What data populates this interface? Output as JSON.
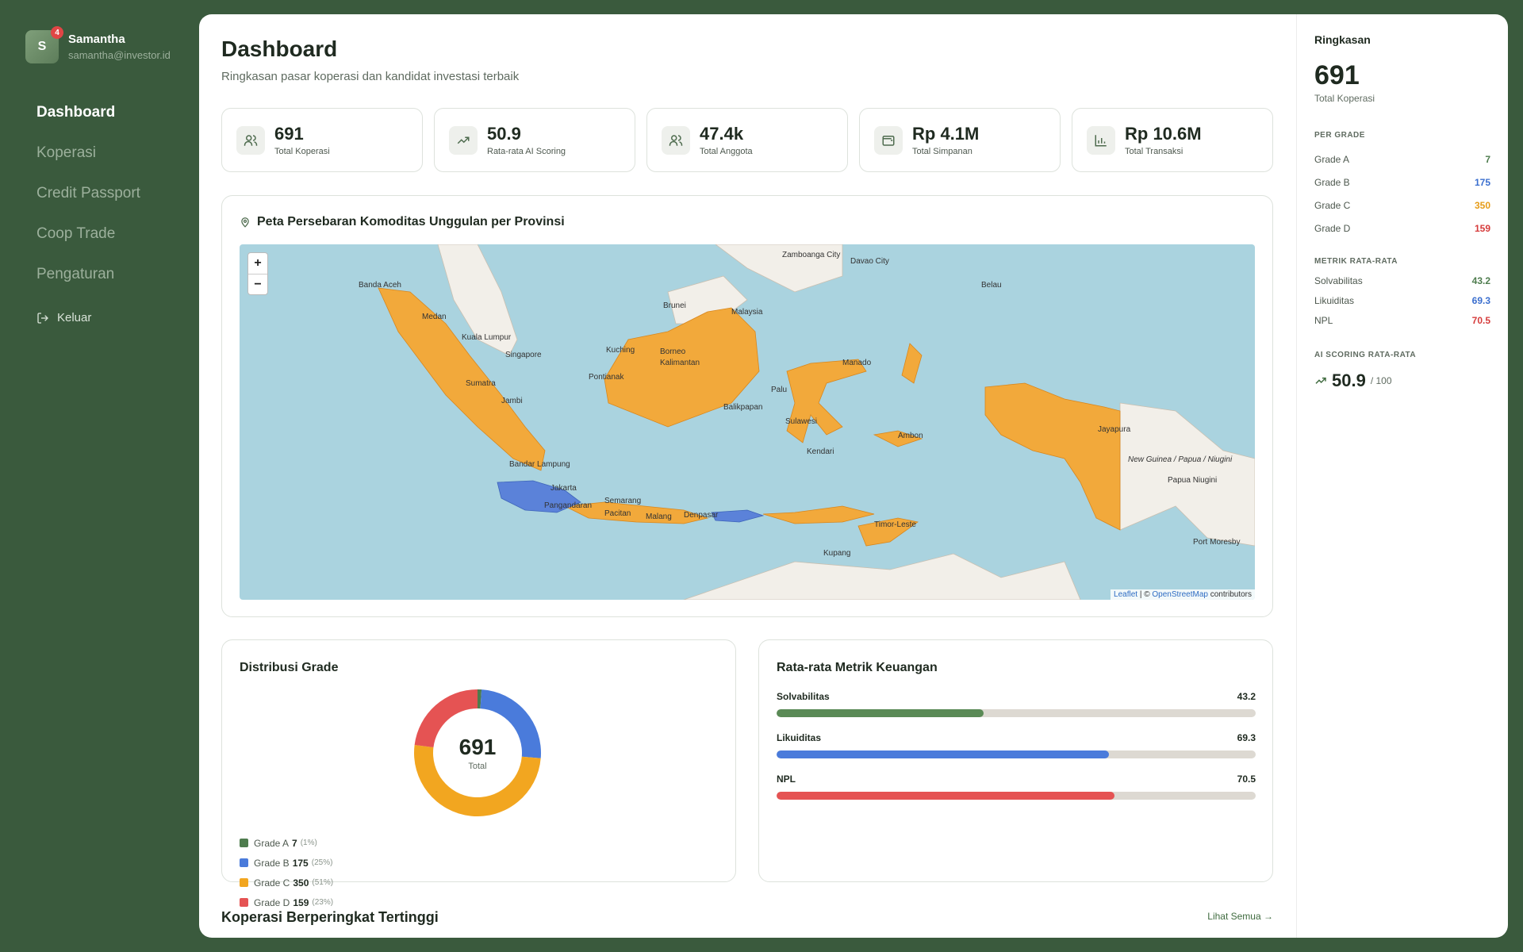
{
  "user": {
    "initial": "S",
    "badge": "4",
    "name": "Samantha",
    "email": "samantha@investor.id"
  },
  "nav": [
    "Dashboard",
    "Koperasi",
    "Credit Passport",
    "Coop Trade",
    "Pengaturan"
  ],
  "logout_label": "Keluar",
  "header": {
    "title": "Dashboard",
    "subtitle": "Ringkasan pasar koperasi dan kandidat investasi terbaik"
  },
  "stats": [
    {
      "value": "691",
      "label": "Total Koperasi",
      "icon": "users-icon"
    },
    {
      "value": "50.9",
      "label": "Rata-rata AI Scoring",
      "icon": "trending-up-icon"
    },
    {
      "value": "47.4k",
      "label": "Total Anggota",
      "icon": "users-icon"
    },
    {
      "value": "Rp 4.1M",
      "label": "Total Simpanan",
      "icon": "wallet-icon"
    },
    {
      "value": "Rp 10.6M",
      "label": "Total Transaksi",
      "icon": "bar-chart-icon"
    }
  ],
  "map": {
    "title": "Peta Persebaran Komoditas Unggulan per Provinsi",
    "zoom_in": "+",
    "zoom_out": "−",
    "attribution": {
      "leaflet": "Leaflet",
      "sep": " | © ",
      "osm": "OpenStreetMap",
      "suffix": " contributors"
    },
    "labels": [
      "Banda Aceh",
      "Medan",
      "Kuala Lumpur",
      "Singapore",
      "Sumatra",
      "Jambi",
      "Bandar Lampung",
      "Jakarta",
      "Semarang",
      "Malang",
      "Borneo",
      "Kalimantan",
      "Pontianak",
      "Balikpapan",
      "Palu",
      "Manado",
      "Sulawesi",
      "Kendari",
      "Ambon",
      "Jayapura",
      "New Guinea / Papua / Niugini",
      "Papua Niugini",
      "Port Moresby",
      "Timor-Leste",
      "Kupang",
      "Zamboanga City",
      "Davao City",
      "Belau",
      "Brunei",
      "Malaysia",
      "Kuching",
      "Pangandaran",
      "Pacitan",
      "Denpasar"
    ],
    "colors": {
      "sea": "#aad3df",
      "land": "#f2efe9",
      "province_orange": "#f2a93b",
      "province_blue": "#5b82d9"
    }
  },
  "grade": {
    "title": "Distribusi Grade",
    "total": "691",
    "total_label": "Total",
    "items": [
      {
        "name": "Grade A",
        "count": "7",
        "pct": "(1%)",
        "color": "#4e7c4e",
        "value": 7
      },
      {
        "name": "Grade B",
        "count": "175",
        "pct": "(25%)",
        "color": "#4a7bdb",
        "value": 175
      },
      {
        "name": "Grade C",
        "count": "350",
        "pct": "(51%)",
        "color": "#f2a620",
        "value": 350
      },
      {
        "name": "Grade D",
        "count": "159",
        "pct": "(23%)",
        "color": "#e55353",
        "value": 159
      }
    ]
  },
  "metrics": {
    "title": "Rata-rata Metrik Keuangan",
    "items": [
      {
        "name": "Solvabilitas",
        "value": "43.2",
        "fraction": 0.432,
        "color": "#5a8a56"
      },
      {
        "name": "Likuiditas",
        "value": "69.3",
        "fraction": 0.693,
        "color": "#4a7bdb"
      },
      {
        "name": "NPL",
        "value": "70.5",
        "fraction": 0.705,
        "color": "#e55353"
      }
    ]
  },
  "top_section": {
    "title": "Koperasi Berperingkat Tertinggi",
    "see_all": "Lihat Semua"
  },
  "summary": {
    "title": "Ringkasan",
    "total": "691",
    "total_label": "Total Koperasi",
    "per_grade_head": "PER GRADE",
    "grades": [
      {
        "name": "Grade A",
        "value": "7",
        "color": "#4e7c4e"
      },
      {
        "name": "Grade B",
        "value": "175",
        "color": "#3b6fcf"
      },
      {
        "name": "Grade C",
        "value": "350",
        "color": "#e69c18"
      },
      {
        "name": "Grade D",
        "value": "159",
        "color": "#d63c3c"
      }
    ],
    "metric_head": "METRIK RATA-RATA",
    "metrics": [
      {
        "name": "Solvabilitas",
        "value": "43.2",
        "color": "#4e7c4e"
      },
      {
        "name": "Likuiditas",
        "value": "69.3",
        "color": "#3b6fcf"
      },
      {
        "name": "NPL",
        "value": "70.5",
        "color": "#d63c3c"
      }
    ],
    "score_head": "AI SCORING RATA-RATA",
    "score": "50.9",
    "score_max": "/ 100"
  }
}
